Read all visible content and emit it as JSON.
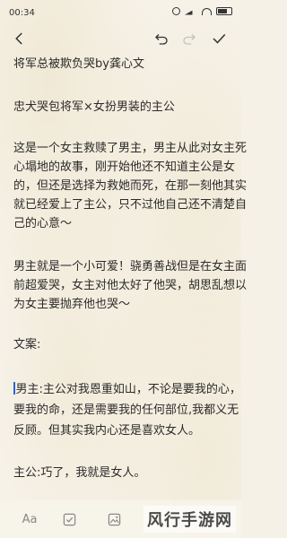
{
  "status_bar": {
    "time": "00:34",
    "icons": [
      "alarm-icon",
      "signal-icon",
      "wifi-icon",
      "battery-icon"
    ]
  },
  "toolbar": {
    "back_icon": "chevron-left-icon",
    "undo_icon": "undo-icon",
    "redo_icon": "redo-icon",
    "done_icon": "check-icon"
  },
  "note": {
    "lines": [
      "将军总被欺负哭by龚心文",
      "",
      "忠犬哭包将军×女扮男装的主公",
      "",
      "这是一个女主救赎了男主，男主从此对女主死",
      "心塌地的故事，刚开始他还不知道主公是女",
      "的，但还是选择为救她而死，在那一刻他其实",
      "就已经爱上了主公，只不过他自己还不清楚自",
      "己的心意～",
      "",
      "男主就是一个小可爱！骁勇善战但是在女主面",
      "前超爱哭，女主对他太好了他哭，胡思乱想以",
      "为女主要抛弃他也哭～",
      "",
      "文案:",
      "",
      "男主:主公对我恩重如山，不论是要我的心，",
      "要我的命，还是需要我的任何部位,我都义无",
      "反顾。但其实我内心还是喜欢女人。",
      "",
      "主公:巧了，我就是女人。"
    ]
  },
  "bottom_bar": {
    "font_label": "Aa",
    "checklist_icon": "checkbox-icon",
    "image_icon": "image-icon"
  },
  "watermark": {
    "text": "风行手游网"
  }
}
